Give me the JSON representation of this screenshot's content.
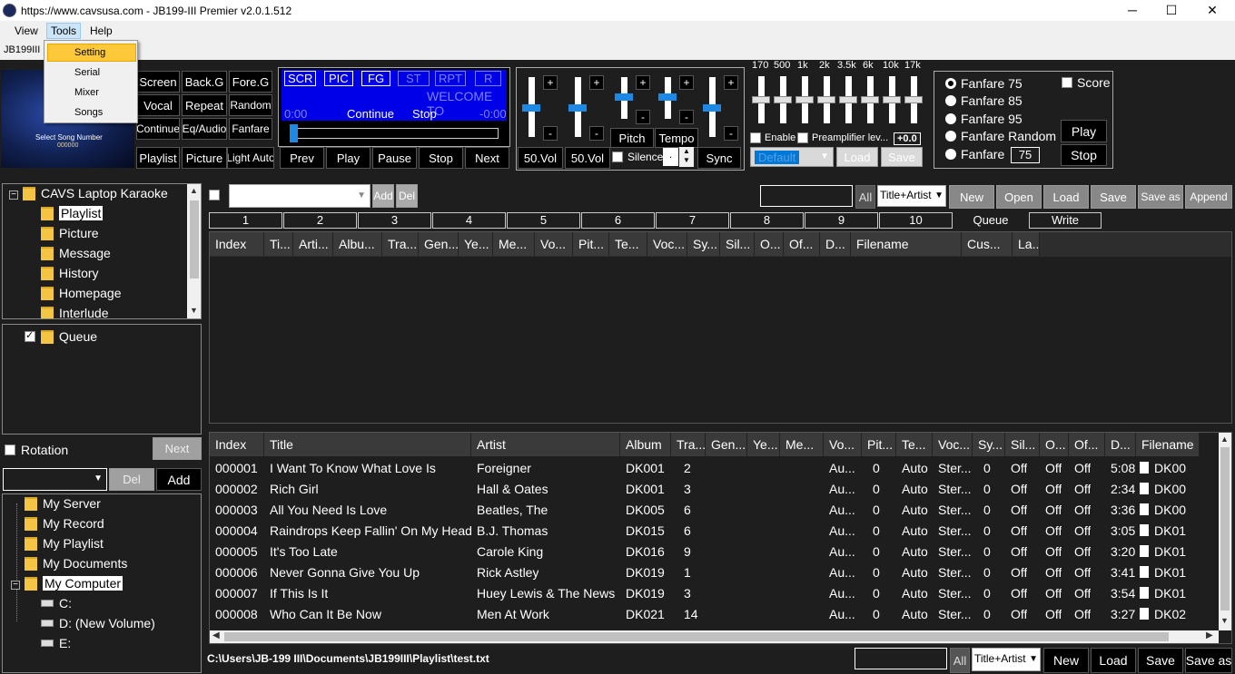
{
  "window": {
    "title": "https://www.cavsusa.com - JB199-III Premier v2.0.1.512",
    "minimize": "─",
    "maximize": "☐",
    "close": "✕"
  },
  "menu": {
    "view": "View",
    "tools": "Tools",
    "help": "Help",
    "tools_items": [
      "Setting",
      "Serial",
      "Mixer",
      "Songs"
    ]
  },
  "tab": {
    "label": "JB199III C"
  },
  "logo": {
    "line1": "Select Song Number",
    "line2": "000000"
  },
  "controls": {
    "screen": "Screen",
    "backg": "Back.G",
    "foreg": "Fore.G",
    "vocal": "Vocal",
    "repeat": "Repeat",
    "random": "Random",
    "continue": "Continue",
    "eqaudio": "Eq/Audio",
    "fanfare": "Fanfare",
    "playlist": "Playlist",
    "picture": "Picture",
    "lightauto": "Light Auto"
  },
  "display": {
    "flags": [
      "SCR",
      "PIC",
      "FG",
      "ST",
      "RPT",
      "R"
    ],
    "welcome": "WELCOME TO",
    "time_left": "0:00",
    "status1": "Continue",
    "status2": "Stop",
    "time_right": "-0:00"
  },
  "transport": {
    "prev": "Prev",
    "play": "Play",
    "pause": "Pause",
    "stop": "Stop",
    "next": "Next"
  },
  "mixer": {
    "vol1": "50.Vol",
    "vol2": "50.Vol",
    "pitch": "Pitch",
    "tempo": "Tempo",
    "silence": "Silence",
    "silence_val": ".",
    "sync": "Sync",
    "plus": "+",
    "minus": "-"
  },
  "eq": {
    "bands": [
      "170",
      "500",
      "1k",
      "2k",
      "3.5k",
      "6k",
      "10k",
      "17k"
    ],
    "enable": "Enable",
    "preamp": "Preamplifier lev...",
    "preamp_val": "+0.0",
    "preset": "Default",
    "load": "Load",
    "save": "Save"
  },
  "fanfare": {
    "options": [
      "Fanfare 75",
      "Fanfare 85",
      "Fanfare 95",
      "Fanfare Random",
      "Fanfare"
    ],
    "custom_val": "75",
    "score": "Score",
    "play": "Play",
    "stop": "Stop"
  },
  "tree1": {
    "root": "CAVS Laptop Karaoke",
    "items": [
      "Playlist",
      "Picture",
      "Message",
      "History",
      "Homepage",
      "Interlude"
    ]
  },
  "queue": {
    "label": "Queue",
    "rotation": "Rotation",
    "next": "Next"
  },
  "browser": {
    "del": "Del",
    "add": "Add",
    "items": [
      "My Server",
      "My Record",
      "My Playlist",
      "My Documents",
      "My Computer"
    ],
    "drives": [
      "C:",
      "D: (New Volume)",
      "E:"
    ]
  },
  "top_toolbar": {
    "add": "Add",
    "del": "Del",
    "all": "All",
    "mode": "Title+Artist",
    "new": "New",
    "open": "Open",
    "load": "Load",
    "save": "Save",
    "saveas": "Save as",
    "append": "Append"
  },
  "num_tabs": [
    "1",
    "2",
    "3",
    "4",
    "5",
    "6",
    "7",
    "8",
    "9",
    "10",
    "Queue",
    "Write"
  ],
  "top_headers": [
    "Index",
    "Ti...",
    "Arti...",
    "Albu...",
    "Tra...",
    "Gen...",
    "Ye...",
    "Me...",
    "Vo...",
    "Pit...",
    "Te...",
    "Voc...",
    "Sy...",
    "Sil...",
    "O...",
    "Of...",
    "D...",
    "Filename",
    "Cus...",
    "La..."
  ],
  "bottom_headers": [
    "Index",
    "Title",
    "Artist",
    "Album",
    "Tra...",
    "Gen...",
    "Ye...",
    "Me...",
    "Vo...",
    "Pit...",
    "Te...",
    "Voc...",
    "Sy...",
    "Sil...",
    "O...",
    "Of...",
    "D...",
    "Filename"
  ],
  "rows": [
    [
      "000001",
      "I Want To Know What Love Is",
      "Foreigner",
      "DK001",
      "2",
      "Au...",
      "0",
      "Auto",
      "Ster...",
      "0",
      "Off",
      "Off",
      "Off",
      "5:08",
      "DK00"
    ],
    [
      "000002",
      "Rich Girl",
      "Hall & Oates",
      "DK001",
      "3",
      "Au...",
      "0",
      "Auto",
      "Ster...",
      "0",
      "Off",
      "Off",
      "Off",
      "2:34",
      "DK00"
    ],
    [
      "000003",
      "All You Need Is Love",
      "Beatles, The",
      "DK005",
      "6",
      "Au...",
      "0",
      "Auto",
      "Ster...",
      "0",
      "Off",
      "Off",
      "Off",
      "3:36",
      "DK00"
    ],
    [
      "000004",
      "Raindrops Keep Fallin' On My Head",
      "B.J. Thomas",
      "DK015",
      "6",
      "Au...",
      "0",
      "Auto",
      "Ster...",
      "0",
      "Off",
      "Off",
      "Off",
      "3:05",
      "DK01"
    ],
    [
      "000005",
      "It's Too Late",
      "Carole King",
      "DK016",
      "9",
      "Au...",
      "0",
      "Auto",
      "Ster...",
      "0",
      "Off",
      "Off",
      "Off",
      "3:20",
      "DK01"
    ],
    [
      "000006",
      "Never Gonna Give You Up",
      "Rick Astley",
      "DK019",
      "1",
      "Au...",
      "0",
      "Auto",
      "Ster...",
      "0",
      "Off",
      "Off",
      "Off",
      "3:41",
      "DK01"
    ],
    [
      "000007",
      "If This Is It",
      "Huey Lewis & The News",
      "DK019",
      "3",
      "Au...",
      "0",
      "Auto",
      "Ster...",
      "0",
      "Off",
      "Off",
      "Off",
      "3:54",
      "DK01"
    ],
    [
      "000008",
      "Who Can It Be Now",
      "Men At Work",
      "DK021",
      "14",
      "Au...",
      "0",
      "Auto",
      "Ster...",
      "0",
      "Off",
      "Off",
      "Off",
      "3:27",
      "DK02"
    ]
  ],
  "bottom_bar": {
    "path": "C:\\Users\\JB-199 III\\Documents\\JB199III\\Playlist\\test.txt",
    "all": "All",
    "mode": "Title+Artist",
    "new": "New",
    "load": "Load",
    "save": "Save",
    "saveas": "Save as"
  }
}
